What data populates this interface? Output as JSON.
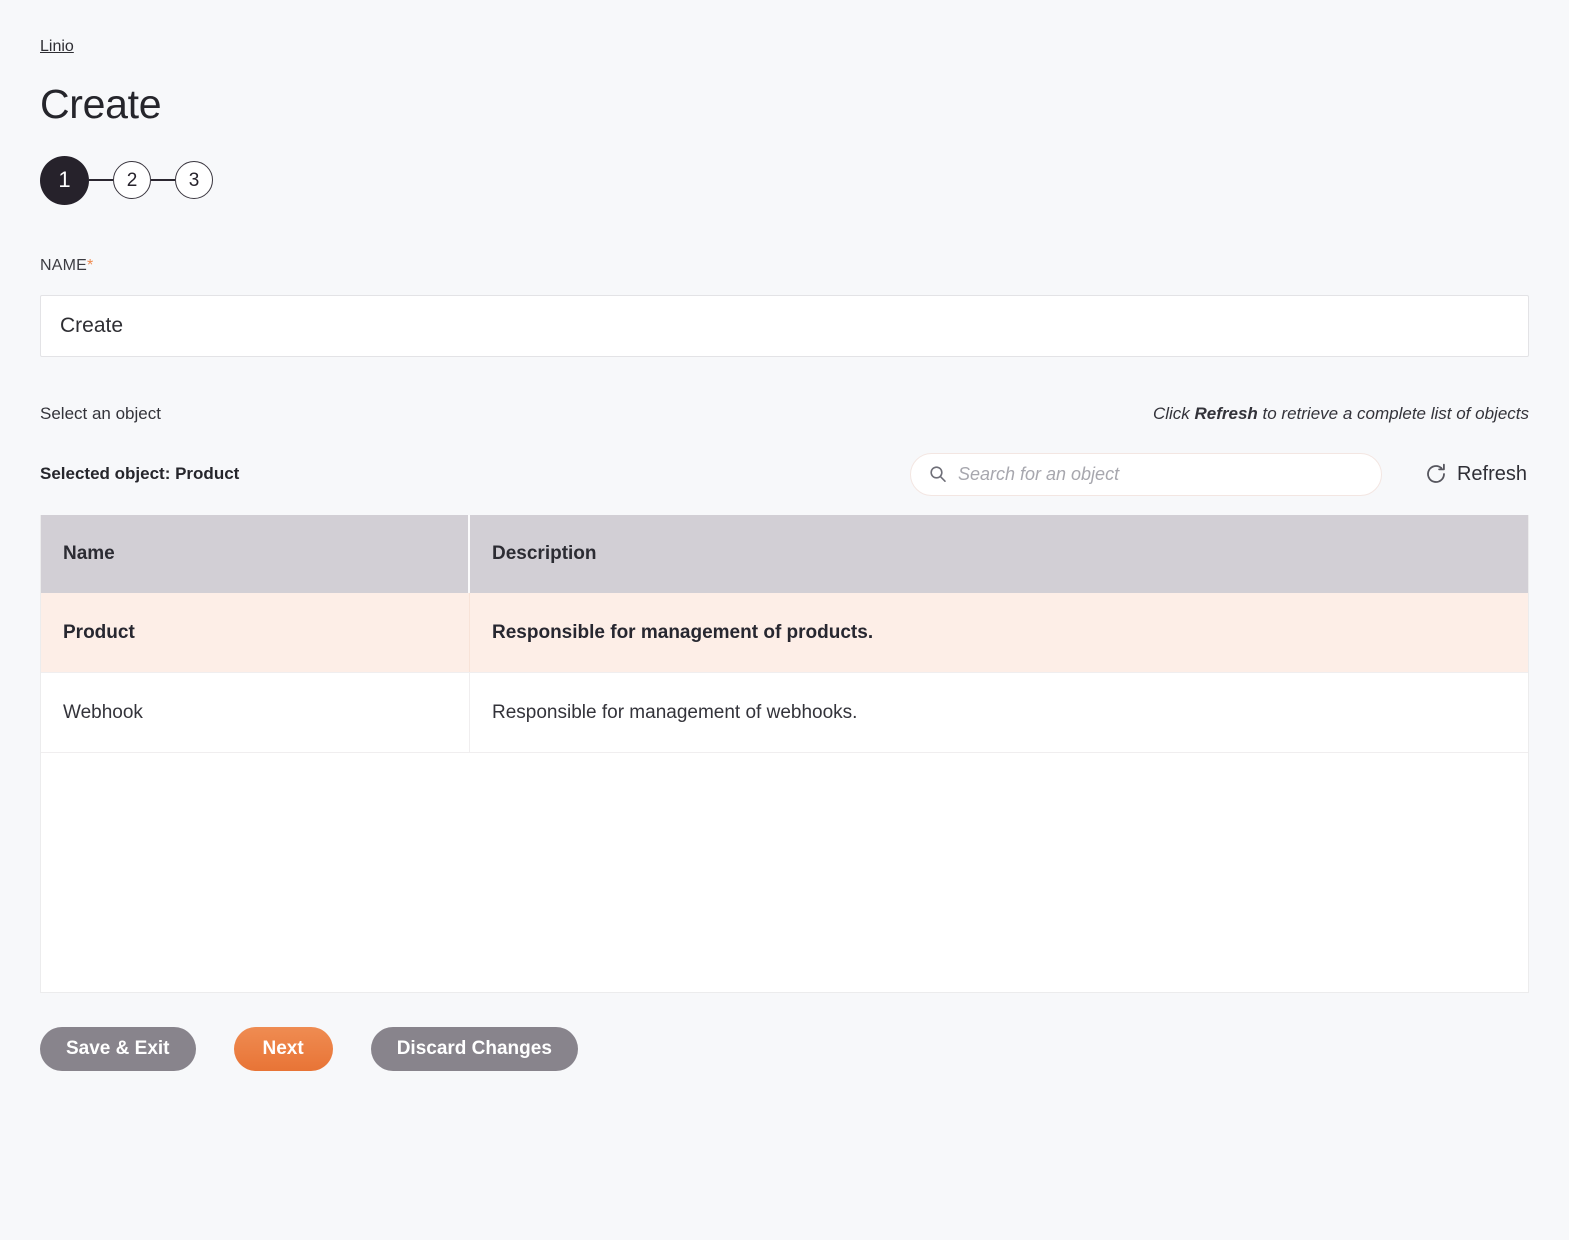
{
  "breadcrumb": {
    "link_label": "Linio"
  },
  "header": {
    "title": "Create"
  },
  "stepper": {
    "steps": [
      {
        "label": "1",
        "state": "active"
      },
      {
        "label": "2",
        "state": "inactive"
      },
      {
        "label": "3",
        "state": "inactive"
      }
    ]
  },
  "name_field": {
    "label": "NAME",
    "required_marker": "*",
    "value": "Create",
    "placeholder": ""
  },
  "object_section": {
    "select_label": "Select an object",
    "hint_prefix": "Click ",
    "hint_bold": "Refresh",
    "hint_suffix": " to retrieve a complete list of objects",
    "selected_object": "Selected object: Product",
    "search": {
      "placeholder": "Search for an object",
      "value": "",
      "icon": "search-icon"
    },
    "refresh": {
      "label": "Refresh",
      "icon": "refresh-icon"
    }
  },
  "table": {
    "columns": [
      "Name",
      "Description"
    ],
    "rows": [
      {
        "name": "Product",
        "description": "Responsible for management of products.",
        "selected": true
      },
      {
        "name": "Webhook",
        "description": "Responsible for management of webhooks.",
        "selected": false
      }
    ]
  },
  "actions": [
    {
      "label": "Save & Exit",
      "style": "grey"
    },
    {
      "label": "Next",
      "style": "orange"
    },
    {
      "label": "Discard Changes",
      "style": "grey"
    }
  ],
  "colors": {
    "page_background": "#f7f8fa",
    "accent_orange": "#e87436",
    "button_grey": "#88848c",
    "table_header": "#d2cfd5",
    "selected_row": "#fdeee7",
    "step_active": "#26222b"
  }
}
